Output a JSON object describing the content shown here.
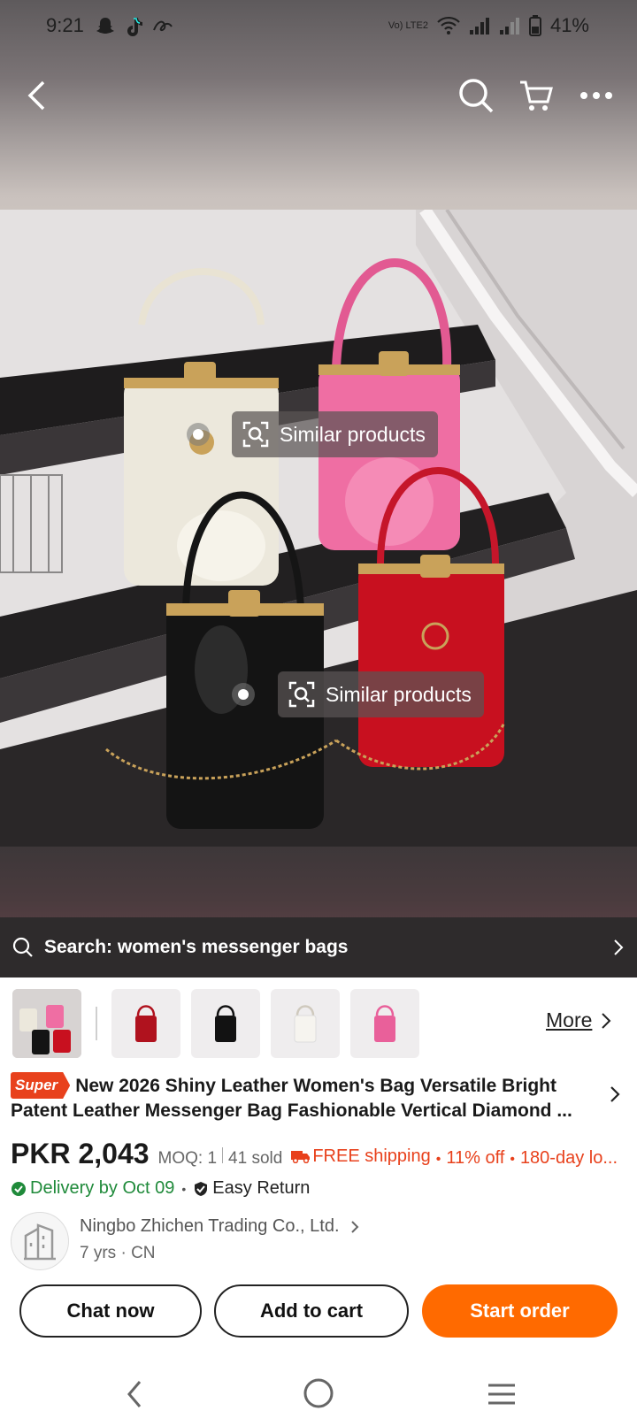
{
  "status_bar": {
    "time": "9:21",
    "battery": "41%",
    "network_label": "Vo) LTE2"
  },
  "top_nav": {
    "back_icon": "back-arrow-icon",
    "search_icon": "search-icon",
    "cart_icon": "cart-icon",
    "more_icon": "more-dots-icon"
  },
  "image_tags": [
    {
      "label": "Similar products"
    },
    {
      "label": "Similar products"
    }
  ],
  "search_strip": {
    "text": "Search: women's messenger bags"
  },
  "thumbnails": {
    "colors": [
      "#cfcbcb",
      "#b0121e",
      "#121212",
      "#e8e6e2",
      "#e9609a"
    ],
    "more_label": "More"
  },
  "product": {
    "badge": "Super",
    "title": "New 2026 Shiny Leather Women's Bag Versatile Bright Patent Leather Messenger Bag Fashionable Vertical Diamond ...",
    "price": "PKR 2,043",
    "moq": "MOQ: 1",
    "sold": "41 sold",
    "free_shipping": "FREE shipping",
    "discount": "11% off",
    "returns": "180-day lo...",
    "delivery": "Delivery by Oct 09",
    "easy_return": "Easy Return"
  },
  "seller": {
    "name": "Ningbo Zhichen Trading Co., Ltd.",
    "years": "7 yrs",
    "country": "CN"
  },
  "actions": {
    "chat": "Chat now",
    "add_to_cart": "Add to cart",
    "start_order": "Start order"
  },
  "colors": {
    "accent": "#ff6a00",
    "promo": "#e8411c",
    "delivery_green": "#1f8a3a"
  }
}
